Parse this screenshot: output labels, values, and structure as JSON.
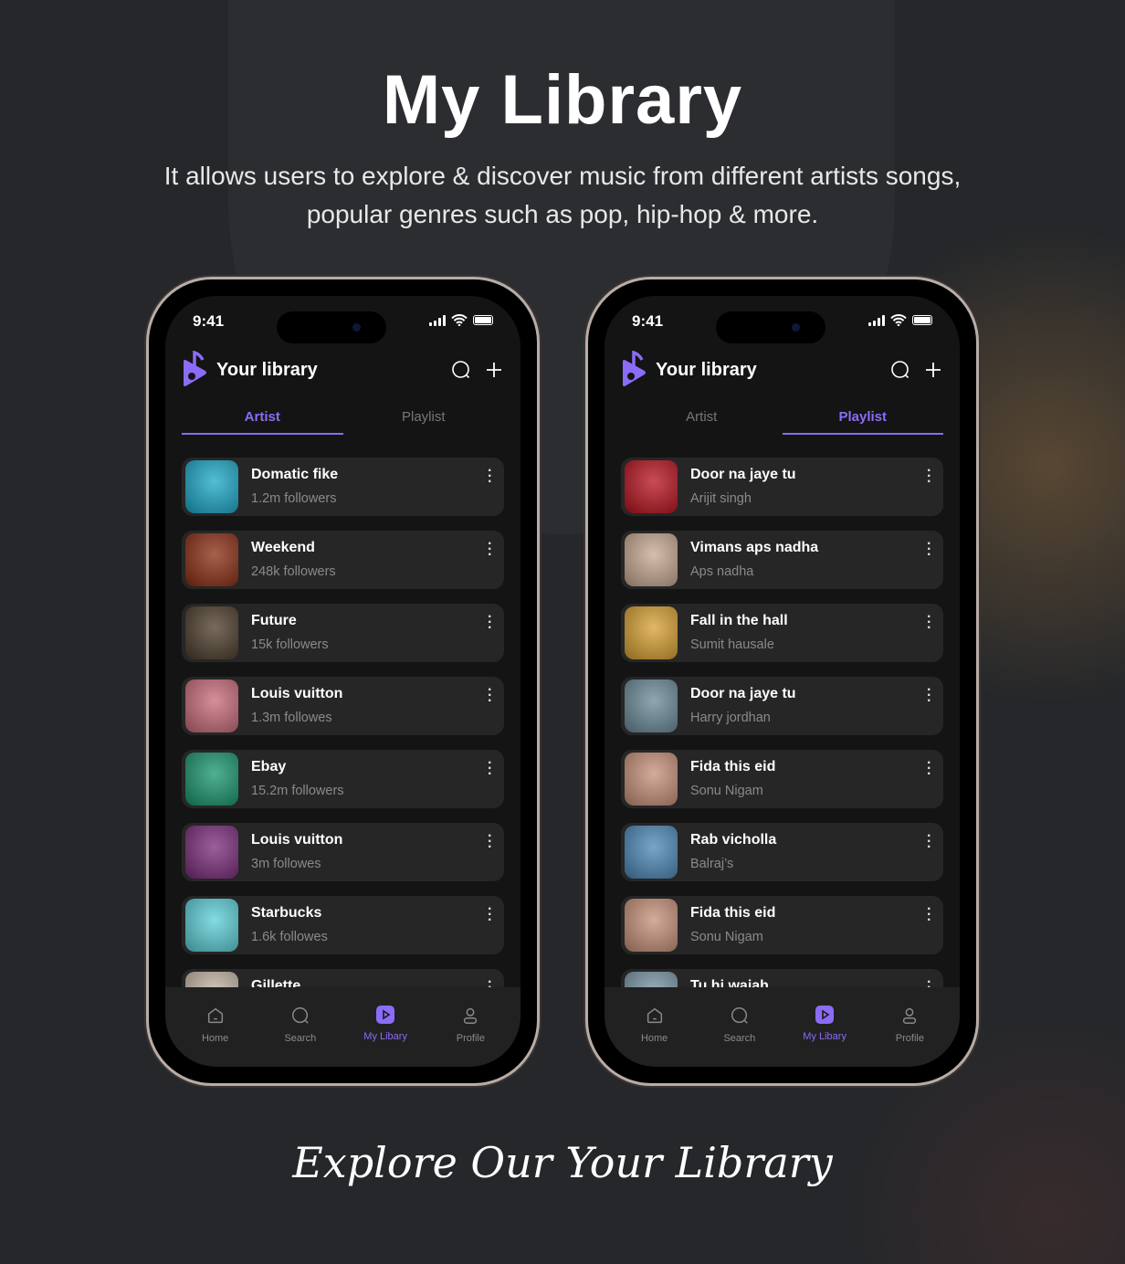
{
  "title": "My Library",
  "subtitle_lines": [
    "It allows users to explore & discover music from different artists songs,",
    "popular genres such as pop, hip-hop & more."
  ],
  "footer": "Explore Our Your Library",
  "accent": "#8b6cf6",
  "phones": [
    {
      "time": "9:41",
      "header": "Your library",
      "tabs": [
        "Artist",
        "Playlist"
      ],
      "active_tab": 0,
      "items": [
        {
          "name": "Domatic fike",
          "sub": "1.2m followers",
          "color": "#1aa8c8"
        },
        {
          "name": "Weekend",
          "sub": "248k followers",
          "color": "#8a2c10"
        },
        {
          "name": "Future",
          "sub": "15k followers",
          "color": "#4a3a28"
        },
        {
          "name": "Louis vuitton",
          "sub": "1.3m followes",
          "color": "#c86a78"
        },
        {
          "name": "Ebay",
          "sub": "15.2m followers",
          "color": "#17966e"
        },
        {
          "name": "Louis vuitton",
          "sub": "3m followes",
          "color": "#7a2a7a"
        },
        {
          "name": "Starbucks",
          "sub": "1.6k followes",
          "color": "#5ad0d8"
        },
        {
          "name": "Gillette",
          "sub": "",
          "color": "#c8b8a8"
        }
      ],
      "nav": [
        "Home",
        "Search",
        "My Libary",
        "Profile"
      ],
      "active_nav": 2
    },
    {
      "time": "9:41",
      "header": "Your library",
      "tabs": [
        "Artist",
        "Playlist"
      ],
      "active_tab": 1,
      "items": [
        {
          "name": "Door na jaye tu",
          "sub": "Arijit singh",
          "color": "#b8101c"
        },
        {
          "name": "Vimans aps nadha",
          "sub": "Aps nadha",
          "color": "#c8a890"
        },
        {
          "name": "Fall in the hall",
          "sub": "Sumit hausale",
          "color": "#d8a030"
        },
        {
          "name": "Door na jaye tu",
          "sub": "Harry jordhan",
          "color": "#6a8a98"
        },
        {
          "name": "Fida this eid",
          "sub": "Sonu Nigam",
          "color": "#c89078"
        },
        {
          "name": "Rab vicholla",
          "sub": "Balraj’s",
          "color": "#4a88b8"
        },
        {
          "name": "Fida this eid",
          "sub": "Sonu Nigam",
          "color": "#c89078"
        },
        {
          "name": "Tu hi waiah",
          "sub": "",
          "color": "#7a98a8"
        }
      ],
      "nav": [
        "Home",
        "Search",
        "My Libary",
        "Profile"
      ],
      "active_nav": 2
    }
  ]
}
